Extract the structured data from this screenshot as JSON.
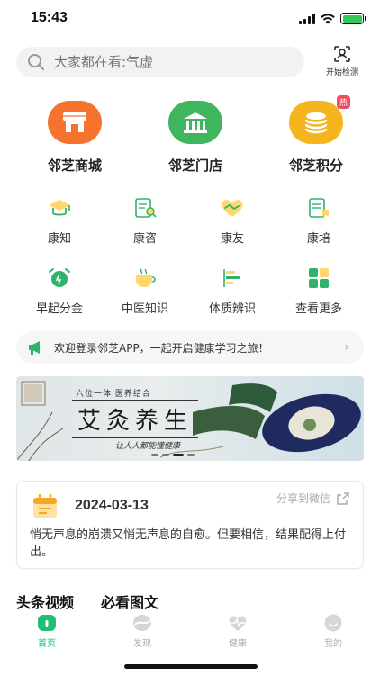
{
  "status": {
    "time": "15:43"
  },
  "search": {
    "placeholder": "大家都在看:气虚"
  },
  "scan": {
    "label": "开始检测"
  },
  "big_entries": [
    {
      "label": "邻芝商城",
      "icon": "shop-icon",
      "color": "#f5732f"
    },
    {
      "label": "邻芝门店",
      "icon": "store-icon",
      "color": "#3fb55e"
    },
    {
      "label": "邻芝积分",
      "icon": "points-icon",
      "color": "#f5b51f",
      "badge": "热"
    }
  ],
  "grid": [
    {
      "label": "康知",
      "icon": "graduation-cap-icon"
    },
    {
      "label": "康咨",
      "icon": "consult-icon"
    },
    {
      "label": "康友",
      "icon": "handshake-icon"
    },
    {
      "label": "康培",
      "icon": "training-icon"
    },
    {
      "label": "早起分金",
      "icon": "alarm-clock-icon"
    },
    {
      "label": "中医知识",
      "icon": "tea-cup-icon"
    },
    {
      "label": "体质辨识",
      "icon": "chart-icon"
    },
    {
      "label": "查看更多",
      "icon": "more-grid-icon"
    }
  ],
  "notice": {
    "text": "欢迎登录邻芝APP，一起开启健康学习之旅！"
  },
  "banner": {
    "subtitle": "六位一体  医养结合",
    "title": "艾灸养生",
    "slogan": "让人人都能懂健康"
  },
  "card": {
    "date": "2024-03-13",
    "share": "分享到微信",
    "text": "悄无声息的崩溃又悄无声息的自愈。但要相信，结果配得上付出。"
  },
  "tabs": [
    "头条视频",
    "必看图文"
  ],
  "nav": [
    {
      "label": "首页",
      "icon": "home-icon",
      "active": true
    },
    {
      "label": "发现",
      "icon": "discover-icon",
      "active": false
    },
    {
      "label": "健康",
      "icon": "heartbeat-icon",
      "active": false
    },
    {
      "label": "我的",
      "icon": "profile-icon",
      "active": false
    }
  ],
  "colors": {
    "accent": "#1fbf7a",
    "green": "#3fb55e",
    "orange": "#f5732f",
    "yellow": "#f5b51f"
  }
}
